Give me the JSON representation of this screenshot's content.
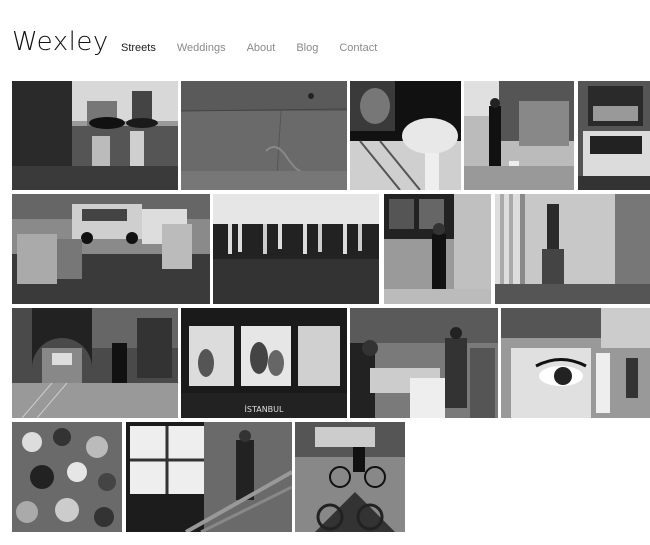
{
  "site": {
    "logo": "Wexley"
  },
  "nav": {
    "items": [
      {
        "label": "Streets",
        "active": true
      },
      {
        "label": "Weddings",
        "active": false
      },
      {
        "label": "About",
        "active": false
      },
      {
        "label": "Blog",
        "active": false
      },
      {
        "label": "Contact",
        "active": false
      }
    ]
  },
  "gallery": {
    "photos": [
      {
        "name": "photo-umbrella-walkers"
      },
      {
        "name": "photo-concrete-wall"
      },
      {
        "name": "photo-dotted-umbrella"
      },
      {
        "name": "photo-man-with-dog"
      },
      {
        "name": "photo-car-on-street"
      },
      {
        "name": "photo-car-and-seated-men"
      },
      {
        "name": "photo-dancers-legs"
      },
      {
        "name": "photo-girl-at-window"
      },
      {
        "name": "photo-statue-and-columns"
      },
      {
        "name": "photo-train-station"
      },
      {
        "name": "photo-istanbul-tram"
      },
      {
        "name": "photo-street-vendor"
      },
      {
        "name": "photo-eye-poster"
      },
      {
        "name": "photo-crowd-above"
      },
      {
        "name": "photo-escalator-window"
      },
      {
        "name": "photo-cyclist-shadow"
      }
    ],
    "tram_caption": "İSTANBUL"
  }
}
